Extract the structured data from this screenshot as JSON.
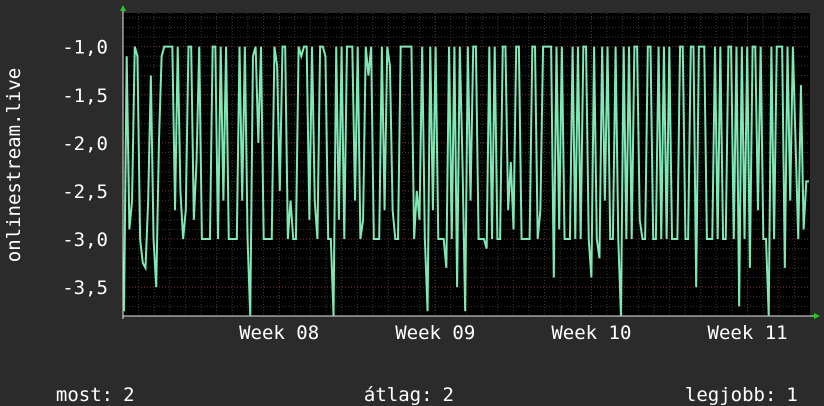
{
  "chart_data": {
    "type": "line",
    "ylabel": "onlinestream.live",
    "ylim": [
      -3.8,
      -0.65
    ],
    "y_ticks": [
      -1.0,
      -1.5,
      -2.0,
      -2.5,
      -3.0,
      -3.5
    ],
    "y_tick_labels": [
      "-1,0",
      "-1,5",
      "-2,0",
      "-2,5",
      "-3,0",
      "-3,5"
    ],
    "x_range": [
      0,
      4.4
    ],
    "x_ticks": [
      {
        "label": "Week 08",
        "x": 1.0
      },
      {
        "label": "Week 09",
        "x": 2.0
      },
      {
        "label": "Week 10",
        "x": 3.0
      },
      {
        "label": "Week 11",
        "x": 4.0
      }
    ],
    "grid": true,
    "series": [
      {
        "color": "#7fe8b5",
        "values": [
          -3.75,
          -1.1,
          -2.9,
          -2.6,
          -1.0,
          -1.1,
          -3.0,
          -3.25,
          -3.3,
          -2.6,
          -1.3,
          -3.0,
          -3.5,
          -2.0,
          -1.1,
          -1.0,
          -1.0,
          -1.0,
          -1.0,
          -2.7,
          -1.0,
          -2.5,
          -3.0,
          -2.7,
          -1.0,
          -1.0,
          -2.8,
          -2.2,
          -1.0,
          -3.0,
          -3.0,
          -3.0,
          -3.0,
          -1.0,
          -1.0,
          -3.0,
          -1.0,
          -2.6,
          -1.0,
          -3.0,
          -3.0,
          -3.0,
          -3.0,
          -1.0,
          -2.6,
          -1.0,
          -3.0,
          -3.8,
          -1.1,
          -1.0,
          -2.0,
          -1.0,
          -3.0,
          -3.0,
          -3.0,
          -3.0,
          -1.0,
          -1.2,
          -2.5,
          -1.0,
          -1.0,
          -3.0,
          -2.6,
          -3.0,
          -3.0,
          -1.0,
          -1.1,
          -1.0,
          -1.0,
          -2.8,
          -1.0,
          -2.6,
          -3.0,
          -1.0,
          -1.0,
          -1.1,
          -3.0,
          -3.0,
          -3.8,
          -1.0,
          -2.8,
          -1.0,
          -3.0,
          -1.0,
          -1.0,
          -1.0,
          -2.6,
          -1.0,
          -3.0,
          -2.8,
          -1.0,
          -1.3,
          -1.0,
          -3.0,
          -3.0,
          -3.0,
          -1.0,
          -2.7,
          -1.0,
          -1.2,
          -2.7,
          -3.0,
          -3.0,
          -1.0,
          -1.0,
          -1.0,
          -1.0,
          -1.0,
          -3.0,
          -2.5,
          -2.8,
          -1.0,
          -3.0,
          -3.75,
          -1.0,
          -2.7,
          -1.0,
          -3.0,
          -3.0,
          -3.0,
          -3.3,
          -1.0,
          -3.0,
          -1.0,
          -3.5,
          -1.0,
          -2.2,
          -3.75,
          -1.0,
          -2.6,
          -1.0,
          -1.0,
          -3.0,
          -3.0,
          -3.0,
          -3.1,
          -1.0,
          -3.0,
          -1.0,
          -3.0,
          -3.0,
          -1.0,
          -1.0,
          -2.7,
          -2.2,
          -2.9,
          -1.0,
          -1.0,
          -3.0,
          -3.0,
          -3.0,
          -3.0,
          -1.0,
          -1.0,
          -3.0,
          -2.7,
          -1.0,
          -1.0,
          -1.0,
          -1.0,
          -3.4,
          -1.0,
          -2.9,
          -1.0,
          -3.0,
          -3.0,
          -3.0,
          -1.0,
          -3.0,
          -1.0,
          -3.0,
          -1.0,
          -1.0,
          -3.0,
          -3.4,
          -1.0,
          -3.0,
          -3.2,
          -1.0,
          -2.6,
          -1.0,
          -3.0,
          -3.0,
          -1.0,
          -3.0,
          -3.8,
          -1.0,
          -3.0,
          -1.0,
          -3.0,
          -1.0,
          -1.0,
          -2.8,
          -3.0,
          -3.0,
          -1.0,
          -1.0,
          -3.0,
          -3.0,
          -1.0,
          -3.0,
          -1.0,
          -3.0,
          -1.0,
          -3.0,
          -3.0,
          -3.0,
          -1.0,
          -1.0,
          -3.0,
          -3.0,
          -1.0,
          -1.0,
          -3.5,
          -1.0,
          -1.0,
          -1.0,
          -3.0,
          -3.0,
          -3.0,
          -1.0,
          -3.0,
          -1.0,
          -3.0,
          -3.0,
          -1.0,
          -1.0,
          -3.0,
          -1.0,
          -3.7,
          -1.0,
          -3.0,
          -1.0,
          -3.3,
          -1.0,
          -1.0,
          -2.7,
          -1.0,
          -3.0,
          -3.0,
          -3.8,
          -1.0,
          -3.0,
          -1.0,
          -1.0,
          -1.0,
          -3.3,
          -1.0,
          -2.6,
          -1.0,
          -2.0,
          -3.0,
          -1.4,
          -2.9,
          -2.4,
          -2.4
        ]
      }
    ]
  },
  "legend": {
    "now_label": "most:",
    "now_value": "2",
    "avg_label": "átlag:",
    "avg_value": "2",
    "max_label": "legjobb:",
    "max_value": "1"
  },
  "colors": {
    "background": "#2b2b2b",
    "plot_background": "#000000",
    "grid_minor": "#3a3a3a",
    "grid_major": "#7a2a2a",
    "axis": "#e8e8e8",
    "arrow": "#22cc22",
    "line": "#7fe8b5"
  }
}
